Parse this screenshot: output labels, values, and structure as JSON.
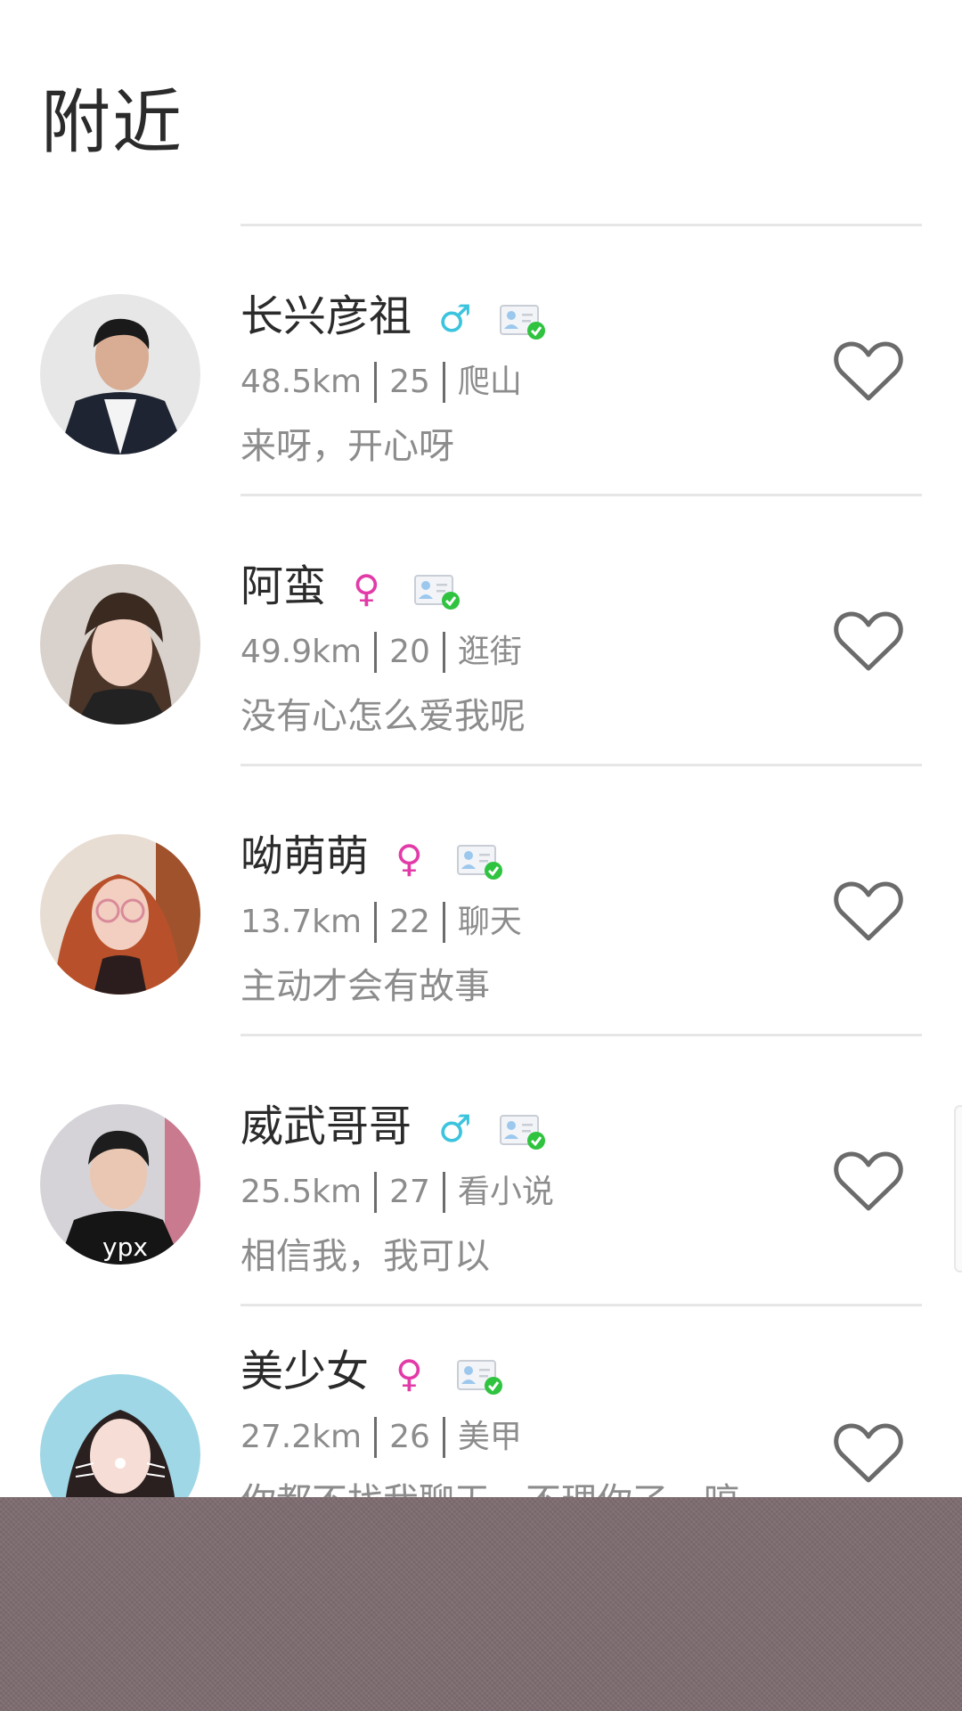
{
  "header": {
    "title": "附近"
  },
  "users": [
    {
      "name": "长兴彦祖",
      "gender": "male",
      "gender_symbol": "♂",
      "distance": "48.5km",
      "age": "25",
      "hobby": "爬山",
      "bio": "来呀，开心呀"
    },
    {
      "name": "阿蛮",
      "gender": "female",
      "gender_symbol": "♀",
      "distance": "49.9km",
      "age": "20",
      "hobby": "逛街",
      "bio": "没有心怎么爱我呢"
    },
    {
      "name": "呦萌萌",
      "gender": "female",
      "gender_symbol": "♀",
      "distance": "13.7km",
      "age": "22",
      "hobby": "聊天",
      "bio": "主动才会有故事"
    },
    {
      "name": "威武哥哥",
      "gender": "male",
      "gender_symbol": "♂",
      "distance": "25.5km",
      "age": "27",
      "hobby": "看小说",
      "bio": "相信我，我可以"
    },
    {
      "name": "美少女",
      "gender": "female",
      "gender_symbol": "♀",
      "distance": "27.2km",
      "age": "26",
      "hobby": "美甲",
      "bio": "你都不找我聊天，不理你了，哼"
    }
  ],
  "icons": {
    "verify": "verified-id-card-icon",
    "like": "heart-outline-icon"
  },
  "colors": {
    "male": "#3cc4de",
    "female": "#e23ba8",
    "verified_check": "#2fc33f",
    "text_primary": "#2b2b2b",
    "text_secondary": "#8c8c8c",
    "overlay": "#7d6b70"
  }
}
